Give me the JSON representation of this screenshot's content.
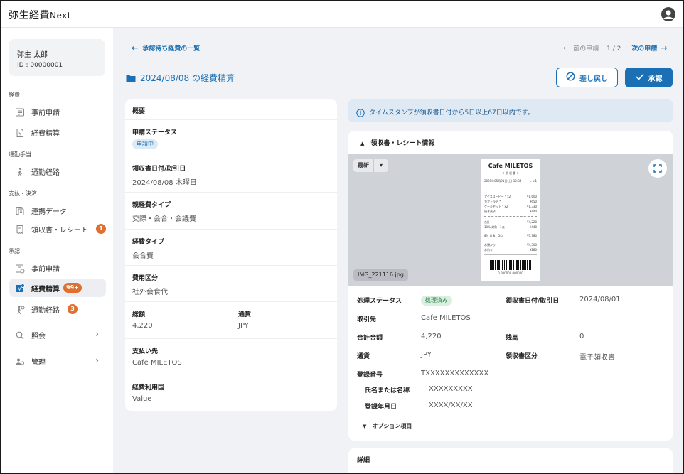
{
  "app": {
    "title": "弥生経費",
    "title_suffix": "Next"
  },
  "user": {
    "name": "弥生 太郎",
    "id_label": "ID : 00000001"
  },
  "sidebar": {
    "sections": [
      {
        "label": "経費"
      },
      {
        "label": "通勤手当"
      },
      {
        "label": "支払・決済"
      },
      {
        "label": "承認"
      }
    ],
    "items": [
      {
        "label": "事前申請"
      },
      {
        "label": "経費精算"
      },
      {
        "label": "通勤経路"
      },
      {
        "label": "連携データ"
      },
      {
        "label": "領収書・レシート",
        "badge": "1"
      },
      {
        "label": "事前申請"
      },
      {
        "label": "経費精算",
        "badge": "99+"
      },
      {
        "label": "通勤経路",
        "badge": "3"
      },
      {
        "label": "照会"
      },
      {
        "label": "管理"
      }
    ]
  },
  "header": {
    "back_label": "承認待ち経費の一覧",
    "prev_label": "前の申請",
    "page_count": "1 / 2",
    "next_label": "次の申請",
    "page_title": "2024/08/08 の経費精算",
    "return_label": "差し戻し",
    "approve_label": "承認"
  },
  "summary": {
    "heading": "概要",
    "status_label": "申請ステータス",
    "status_value": "申請中",
    "date_label": "領収書日付/取引日",
    "date_value": "2024/08/08 木曜日",
    "parent_type_label": "親経費タイプ",
    "parent_type_value": "交際・会合・会議費",
    "type_label": "経費タイプ",
    "type_value": "会合費",
    "category_label": "費用区分",
    "category_value": "社外会食代",
    "total_label": "総額",
    "total_value": "4,220",
    "currency_label": "通貨",
    "currency_value": "JPY",
    "payee_label": "支払い先",
    "payee_value": "Cafe MILETOS",
    "country_label": "経費利用国",
    "country_value": "Value"
  },
  "info_banner": {
    "text": "タイムスタンプが領収書日付から5日以上67日以内です。"
  },
  "receipt": {
    "heading": "領収書・レシート情報",
    "version_label": "最新",
    "filename": "IMG_221116.jpg",
    "image": {
      "shop": "Cafe MILETOS",
      "subtitle": "＜ 領 収 書 ＞",
      "lines": [
        {
          "l": "2021年05月01日(土) 12:34",
          "r": "レジ1"
        },
        {
          "l": "アイスコーヒー * x2",
          "r": "¥1,600"
        },
        {
          "l": "カフェラテ *",
          "r": "¥650"
        },
        {
          "l": "ケーキセット * x2",
          "r": "¥1,330"
        },
        {
          "l": "焼き菓子",
          "r": "¥440"
        },
        {
          "l": "合計",
          "r": "¥4,220"
        },
        {
          "l": "10% 対象　1点",
          "r": "¥440"
        },
        {
          "l": "8% 対象　5点",
          "r": "¥3,780"
        },
        {
          "l": "お預かり",
          "r": "¥4,500"
        },
        {
          "l": "お釣り",
          "r": "¥280"
        }
      ],
      "barcode_number": "0 000000 000000"
    },
    "fields": {
      "proc_status_label": "処理ステータス",
      "proc_status_value": "処理済み",
      "receipt_date_label": "領収書日付/取引日",
      "receipt_date_value": "2024/08/01",
      "vendor_label": "取引先",
      "vendor_value": "Cafe MILETOS",
      "amount_label": "合計金額",
      "amount_value": "4,220",
      "balance_label": "残高",
      "balance_value": "0",
      "currency_label": "通貨",
      "currency_value": "JPY",
      "receipt_type_label": "領収書区分",
      "receipt_type_value": "電子領収書",
      "reg_no_label": "登録番号",
      "reg_no_value": "TXXXXXXXXXXXXX",
      "name_label": "氏名または名称",
      "name_value": "XXXXXXXXX",
      "reg_date_label": "登録年月日",
      "reg_date_value": "XXXX/XX/XX"
    },
    "options_label": "オプション項目"
  },
  "details": {
    "heading": "詳細"
  },
  "colors": {
    "accent": "#1a6fb5",
    "badge": "#e07030",
    "background": "#f0f2f5"
  },
  "icons": [
    "user-icon",
    "arrow-left-icon",
    "arrow-right-icon",
    "folder-icon",
    "ban-icon",
    "check-icon",
    "info-icon",
    "expand-icon",
    "caret-up-icon",
    "caret-down-icon",
    "chevron-right-icon"
  ]
}
